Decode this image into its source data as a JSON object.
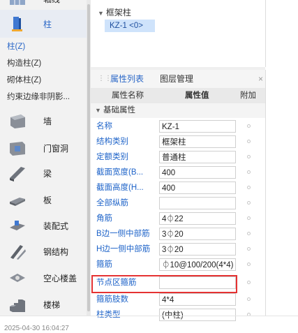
{
  "nav": {
    "top_label": "轴线",
    "column_label": "柱",
    "sub_items": [
      "柱(Z)",
      "构造柱(Z)",
      "砌体柱(Z)",
      "约束边缘非阴影..."
    ],
    "categories": [
      "墙",
      "门窗洞",
      "梁",
      "板",
      "装配式",
      "钢结构",
      "空心楼盖",
      "楼梯"
    ]
  },
  "tree": {
    "root_label": "框架柱",
    "child_label": "KZ-1 <0>"
  },
  "tabs": {
    "properties": "属性列表",
    "layers": "图层管理",
    "close": "×"
  },
  "table": {
    "header_name": "属性名称",
    "header_value": "属性值",
    "header_extra": "附加",
    "group": "基础属性",
    "rows": [
      {
        "name": "名称",
        "value": "KZ-1"
      },
      {
        "name": "结构类别",
        "value": "框架柱"
      },
      {
        "name": "定额类别",
        "value": "普通柱"
      },
      {
        "name": "截面宽度(B...",
        "value": "400"
      },
      {
        "name": "截面高度(H...",
        "value": "400"
      },
      {
        "name": "全部纵筋",
        "value": ""
      },
      {
        "name": "角筋",
        "value": "4⏀22"
      },
      {
        "name": "B边一侧中部筋",
        "value": "3⏀20"
      },
      {
        "name": "H边一侧中部筋",
        "value": "3⏀20"
      },
      {
        "name": "箍筋",
        "value": "⏀10@100/200(4*4)"
      },
      {
        "name": "节点区箍筋",
        "value": ""
      },
      {
        "name": "箍筋肢数",
        "value": "4*4"
      },
      {
        "name": "柱类型",
        "value": "(中柱)"
      }
    ]
  },
  "timestamp": "2025-04-30 16:04:27",
  "colors": {
    "accent": "#2a67c7",
    "property_name": "#1f64c9",
    "highlight": "#e53232",
    "tree_selection": "#cfe3fb"
  }
}
